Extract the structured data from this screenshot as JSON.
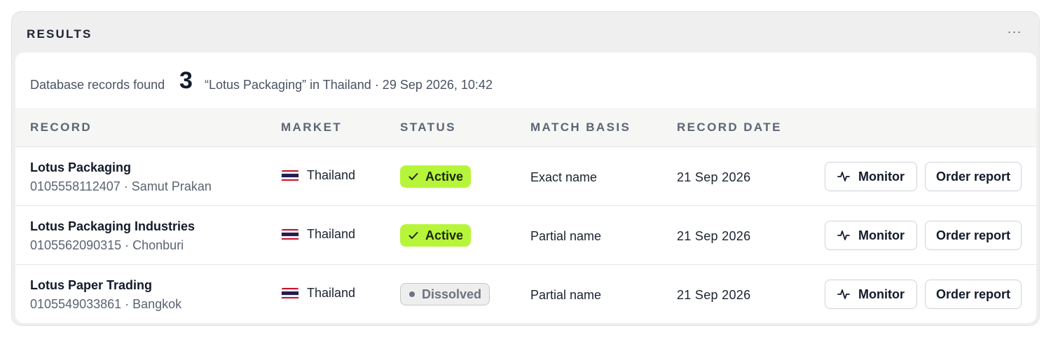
{
  "panel": {
    "title": "RESULTS",
    "more_label": "···"
  },
  "summary": {
    "label": "Database records found",
    "count": "3",
    "query": "“Lotus Packaging” in Thailand · 29 Sep 2026, 10:42"
  },
  "columns": {
    "record": "RECORD",
    "market": "MARKET",
    "status": "STATUS",
    "match_basis": "MATCH BASIS",
    "record_date": "RECORD DATE"
  },
  "rows": [
    {
      "name": "Lotus Packaging",
      "meta": "0105558112407 · Samut Prakan",
      "market": "Thailand",
      "status": "Active",
      "match": "Exact name",
      "date": "21 Sep 2026",
      "monitor_label": "Monitor",
      "order_label": "Order report"
    },
    {
      "name": "Lotus Packaging Industries",
      "meta": "0105562090315 · Chonburi",
      "market": "Thailand",
      "status": "Active",
      "match": "Partial name",
      "date": "21 Sep 2026",
      "monitor_label": "Monitor",
      "order_label": "Order report"
    },
    {
      "name": "Lotus Paper Trading",
      "meta": "0105549033861 · Bangkok",
      "market": "Thailand",
      "status": "Dissolved",
      "match": "Partial name",
      "date": "21 Sep 2026",
      "monitor_label": "Monitor",
      "order_label": "Order report"
    }
  ],
  "icons": {
    "status_active": "check-icon",
    "status_dissolved": "dot-icon",
    "monitor": "activity-pulse-icon",
    "market_flag": "thailand-flag-icon",
    "more": "more-horizontal-icon"
  },
  "colors": {
    "active_badge_bg": "#b7f53a",
    "dissolved_badge_bg": "#eeeeee",
    "panel_bg": "#efefef",
    "header_row_bg": "#f6f6f4"
  }
}
